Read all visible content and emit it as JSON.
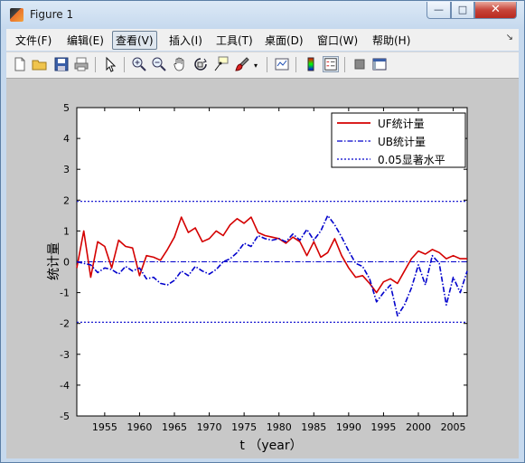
{
  "window": {
    "title": "Figure 1"
  },
  "controls": {
    "minimize": "—",
    "maximize": "□",
    "close": "✕"
  },
  "menu": [
    {
      "label": "文件(F)"
    },
    {
      "label": "编辑(E)"
    },
    {
      "label": "查看(V)"
    },
    {
      "label": "插入(I)"
    },
    {
      "label": "工具(T)"
    },
    {
      "label": "桌面(D)"
    },
    {
      "label": "窗口(W)"
    },
    {
      "label": "帮助(H)"
    }
  ],
  "menu_active": "查看(V)",
  "toolbar_icons": [
    "new-figure-icon",
    "open-file-icon",
    "save-icon",
    "print-icon",
    "pointer-arrow-icon",
    "zoom-in-icon",
    "zoom-out-icon",
    "pan-hand-icon",
    "rotate-3d-icon",
    "data-cursor-icon",
    "brush-icon",
    "brush-dropdown-icon",
    "link-plot-icon",
    "colorbar-icon",
    "legend-icon",
    "hide-plot-tools-icon",
    "show-plot-tools-icon"
  ],
  "chart_data": {
    "type": "line",
    "xlabel": "t （year）",
    "ylabel": "统计量",
    "xlim": [
      1951,
      2007
    ],
    "ylim": [
      -5,
      5
    ],
    "xticks": [
      1955,
      1960,
      1965,
      1970,
      1975,
      1980,
      1985,
      1990,
      1995,
      2000,
      2005
    ],
    "yticks": [
      -5,
      -4,
      -3,
      -2,
      -1,
      0,
      1,
      2,
      3,
      4,
      5
    ],
    "legend_position": "top-right",
    "x": [
      1951,
      1952,
      1953,
      1954,
      1955,
      1956,
      1957,
      1958,
      1959,
      1960,
      1961,
      1962,
      1963,
      1964,
      1965,
      1966,
      1967,
      1968,
      1969,
      1970,
      1971,
      1972,
      1973,
      1974,
      1975,
      1976,
      1977,
      1978,
      1979,
      1980,
      1981,
      1982,
      1983,
      1984,
      1985,
      1986,
      1987,
      1988,
      1989,
      1990,
      1991,
      1992,
      1993,
      1994,
      1995,
      1996,
      1997,
      1998,
      1999,
      2000,
      2001,
      2002,
      2003,
      2004,
      2005,
      2006,
      2007
    ],
    "series": [
      {
        "name": "UF统计量",
        "color": "#d40000",
        "style": "solid",
        "values": [
          -0.2,
          1.0,
          -0.5,
          0.65,
          0.5,
          -0.2,
          0.7,
          0.5,
          0.45,
          -0.45,
          0.2,
          0.15,
          0.05,
          0.4,
          0.8,
          1.45,
          0.95,
          1.1,
          0.65,
          0.75,
          1.0,
          0.85,
          1.2,
          1.4,
          1.25,
          1.45,
          0.95,
          0.85,
          0.8,
          0.75,
          0.6,
          0.8,
          0.65,
          0.2,
          0.65,
          0.15,
          0.3,
          0.75,
          0.2,
          -0.2,
          -0.5,
          -0.45,
          -0.7,
          -1.0,
          -0.65,
          -0.55,
          -0.7,
          -0.3,
          0.1,
          0.35,
          0.25,
          0.4,
          0.3,
          0.1,
          0.2,
          0.1,
          0.1
        ]
      },
      {
        "name": "UB统计量",
        "color": "#0000cc",
        "style": "dashdot",
        "values": [
          0.0,
          -0.05,
          -0.1,
          -0.35,
          -0.2,
          -0.25,
          -0.4,
          -0.15,
          -0.3,
          -0.2,
          -0.55,
          -0.5,
          -0.7,
          -0.75,
          -0.6,
          -0.3,
          -0.45,
          -0.15,
          -0.3,
          -0.4,
          -0.25,
          0.0,
          0.1,
          0.3,
          0.6,
          0.5,
          0.85,
          0.75,
          0.7,
          0.75,
          0.65,
          0.9,
          0.7,
          1.05,
          0.7,
          1.0,
          1.5,
          1.2,
          0.8,
          0.35,
          -0.05,
          -0.15,
          -0.55,
          -1.3,
          -1.0,
          -0.75,
          -1.75,
          -1.4,
          -0.85,
          -0.1,
          -0.75,
          0.2,
          -0.05,
          -1.4,
          -0.5,
          -1.0,
          -0.3
        ]
      },
      {
        "name": "0.05显著水平",
        "color": "#0000cc",
        "style": "dotted",
        "hlines": [
          1.96,
          -1.96
        ]
      }
    ],
    "reference_line": {
      "y": 0,
      "style": "dashdot",
      "color": "#0000cc"
    }
  }
}
